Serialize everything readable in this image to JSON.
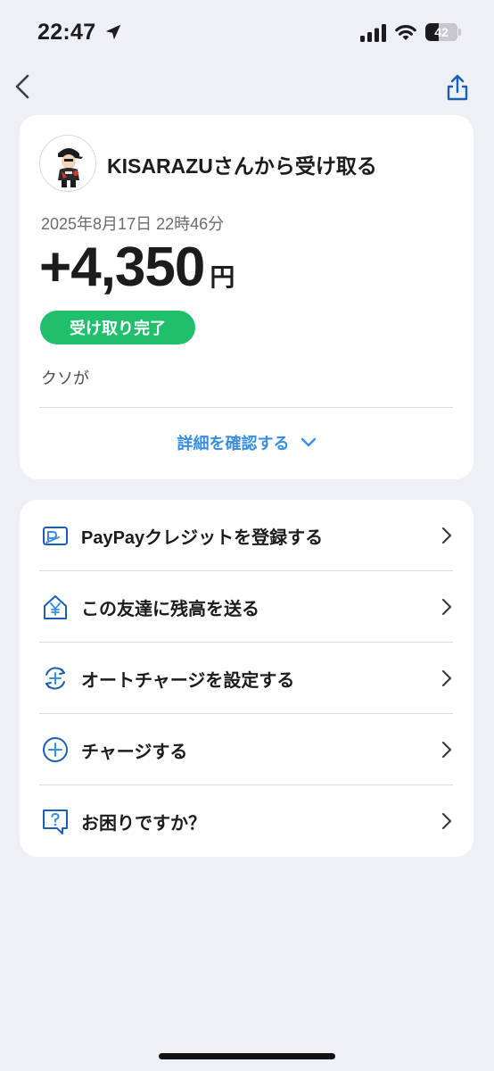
{
  "status_bar": {
    "time": "22:47",
    "battery": "42",
    "battery_level": 0.42
  },
  "nav": {
    "back_icon": "chevron-left-icon",
    "share_icon": "share-icon"
  },
  "transaction": {
    "title": "KISARAZUさんから受け取る",
    "date": "2025年8月17日 22時46分",
    "amount": "+4,350",
    "unit": "円",
    "status": "受け取り完了",
    "memo": "クソが",
    "details_link": "詳細を確認する"
  },
  "menu": {
    "items": [
      {
        "label": "PayPayクレジットを登録する",
        "icon": "credit-card-icon"
      },
      {
        "label": "この友達に残高を送る",
        "icon": "yen-house-icon"
      },
      {
        "label": "オートチャージを設定する",
        "icon": "auto-charge-icon"
      },
      {
        "label": "チャージする",
        "icon": "plus-circle-icon"
      },
      {
        "label": "お困りですか？",
        "icon": "help-bubble-icon"
      }
    ]
  },
  "colors": {
    "accent": "#3a8ee0",
    "success": "#1fbf6b",
    "icon_blue": "#1a5fb4",
    "background": "#eef0f5"
  }
}
